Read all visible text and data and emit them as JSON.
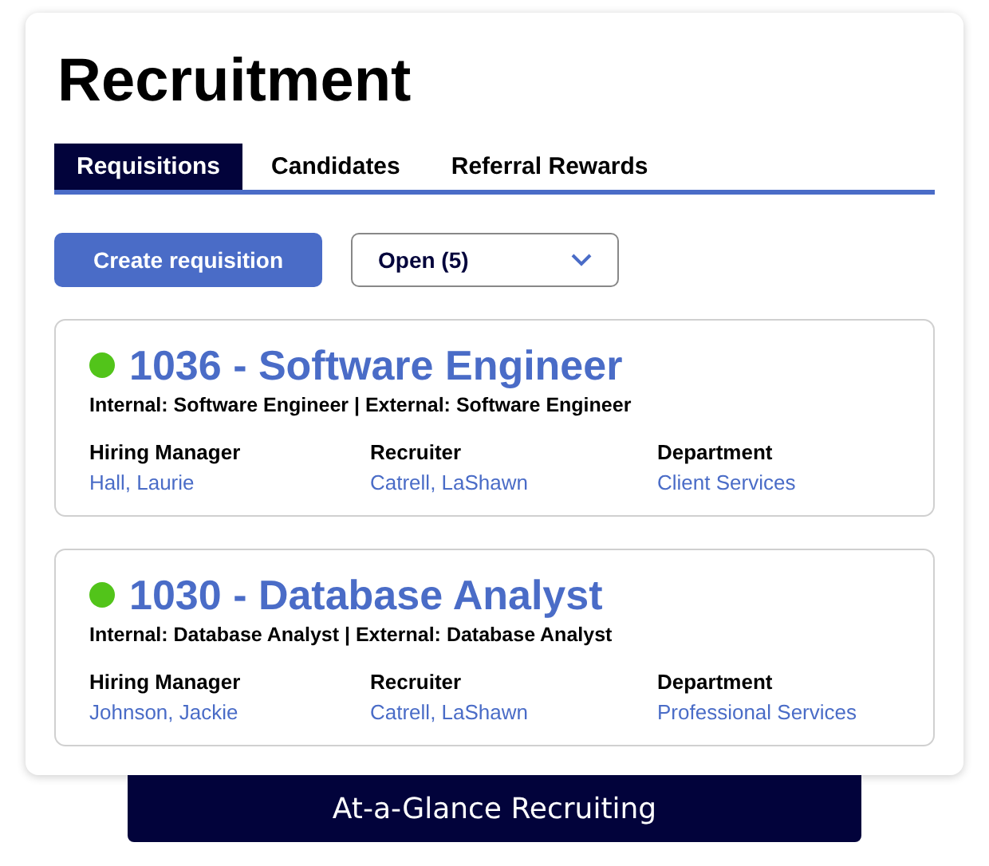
{
  "title": "Recruitment",
  "tabs": [
    {
      "label": "Requisitions",
      "selected": true
    },
    {
      "label": "Candidates",
      "selected": false
    },
    {
      "label": "Referral Rewards",
      "selected": false
    }
  ],
  "create_button": "Create requisition",
  "filter": {
    "value": "Open (5)"
  },
  "requisitions": [
    {
      "title": "1036 - Software Engineer",
      "color": "#52c41a",
      "subtitle": "Internal: Software Engineer | External: Software Engineer",
      "fields": [
        {
          "label": "Hiring Manager",
          "value": "Hall, Laurie"
        },
        {
          "label": "Recruiter",
          "value": "Catrell, LaShawn"
        },
        {
          "label": "Department",
          "value": "Client Services"
        }
      ]
    },
    {
      "title": "1030 - Database Analyst",
      "color": "#52c41a",
      "subtitle": "Internal: Database Analyst | External: Database Analyst",
      "fields": [
        {
          "label": "Hiring Manager",
          "value": "Johnson, Jackie"
        },
        {
          "label": "Recruiter",
          "value": "Catrell, LaShawn"
        },
        {
          "label": "Department",
          "value": "Professional Services"
        }
      ]
    }
  ],
  "banner": "At-a-Glance Recruiting"
}
